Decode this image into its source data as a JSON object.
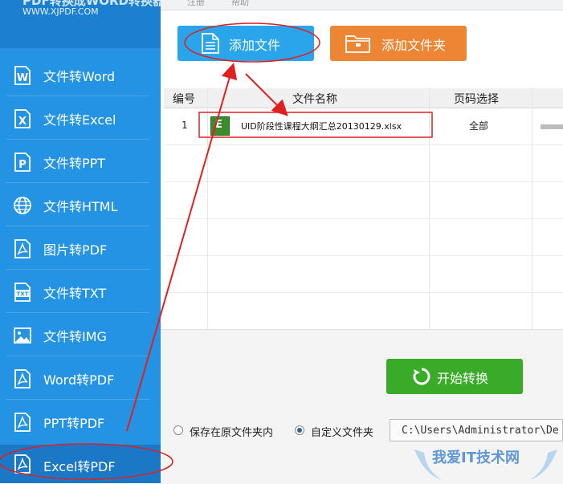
{
  "app": {
    "title": "PDF转换成WORD转换器",
    "url": "WWW.XJPDF.COM"
  },
  "topmenu": [
    "注册",
    "帮助"
  ],
  "sidebar": {
    "items": [
      {
        "label": "文件转Word",
        "icon": "word-icon",
        "glyph": "W"
      },
      {
        "label": "文件转Excel",
        "icon": "excel-icon",
        "glyph": "X"
      },
      {
        "label": "文件转PPT",
        "icon": "ppt-icon",
        "glyph": "P"
      },
      {
        "label": "文件转HTML",
        "icon": "globe-icon",
        "glyph": ""
      },
      {
        "label": "图片转PDF",
        "icon": "pdf-icon",
        "glyph": ""
      },
      {
        "label": "文件转TXT",
        "icon": "txt-icon",
        "glyph": "TXT"
      },
      {
        "label": "文件转IMG",
        "icon": "image-icon",
        "glyph": ""
      },
      {
        "label": "Word转PDF",
        "icon": "pdf-icon",
        "glyph": ""
      },
      {
        "label": "PPT转PDF",
        "icon": "pdf-icon",
        "glyph": ""
      },
      {
        "label": "Excel转PDF",
        "icon": "pdf-icon",
        "glyph": "",
        "active": true
      }
    ]
  },
  "toolbar": {
    "add_file": "添加文件",
    "add_folder": "添加文件夹"
  },
  "table": {
    "headers": [
      "编号",
      "文件名称",
      "页码选择"
    ],
    "rows": [
      {
        "index": "1",
        "icon_glyph": "E",
        "filename": "UID阶段性课程大纲汇总20130129.xlsx",
        "pages": "全部"
      }
    ]
  },
  "actions": {
    "start": "开始转换"
  },
  "output": {
    "option_original": "保存在原文件夹内",
    "option_custom": "自定义文件夹",
    "path": "C:\\Users\\Administrator\\De"
  },
  "watermark": {
    "text": "我爱IT技术网"
  },
  "colors": {
    "sidebar": "#2593e3",
    "add_file": "#2aa5eb",
    "add_folder": "#ec8534",
    "start": "#3aab29",
    "annotation": "#e02020"
  }
}
